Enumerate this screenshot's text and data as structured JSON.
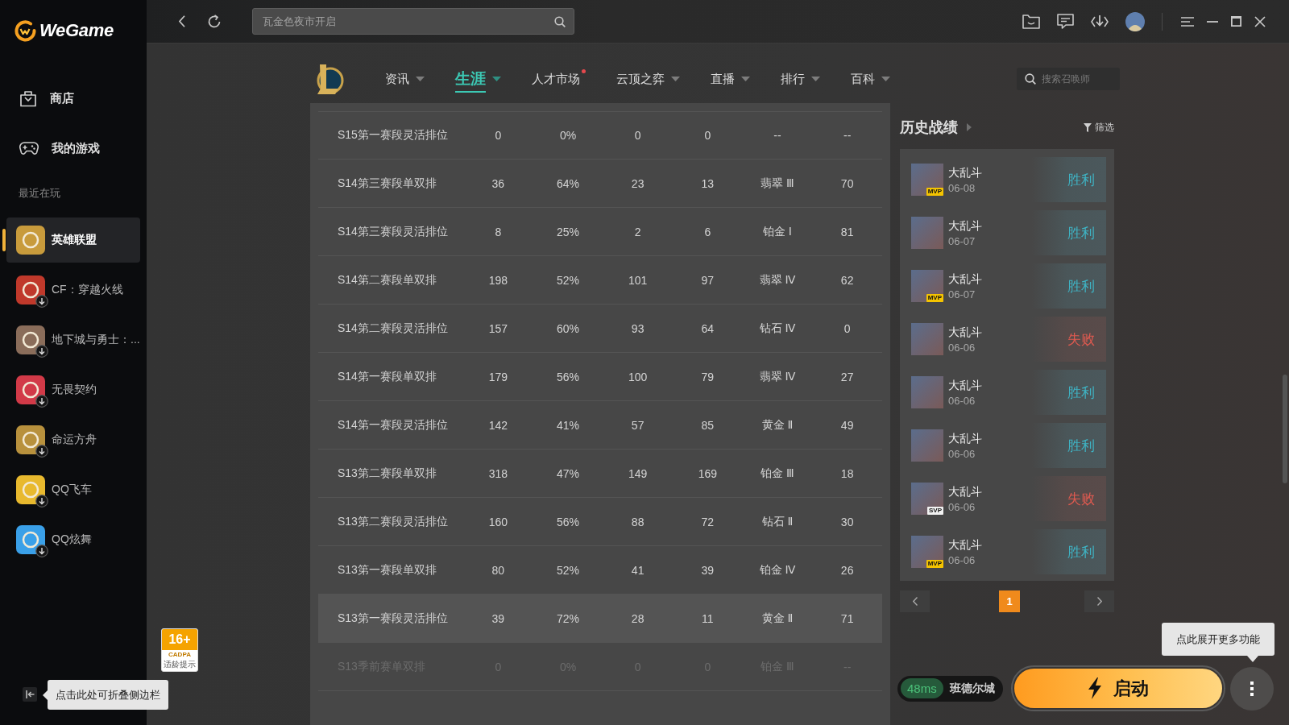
{
  "sidebar": {
    "logo": "WeGame",
    "nav": [
      {
        "label": "商店",
        "kind": "store",
        "selected": false
      },
      {
        "label": "我的游戏",
        "kind": "library",
        "selected": false
      }
    ],
    "recent_label": "最近在玩",
    "games": [
      {
        "name": "英雄联盟",
        "selected": true,
        "installed": true,
        "color": "#c89b3c"
      },
      {
        "name": "CF：穿越火线",
        "selected": false,
        "installed": false,
        "color": "#c0392b"
      },
      {
        "name": "地下城与勇士：...",
        "selected": false,
        "installed": false,
        "color": "#8a6d5a"
      },
      {
        "name": "无畏契约",
        "selected": false,
        "installed": false,
        "color": "#d23a48"
      },
      {
        "name": "命运方舟",
        "selected": false,
        "installed": false,
        "color": "#b8913d"
      },
      {
        "name": "QQ飞车",
        "selected": false,
        "installed": false,
        "color": "#e8b92e"
      },
      {
        "name": "QQ炫舞",
        "selected": false,
        "installed": false,
        "color": "#3aa0e8"
      }
    ],
    "collapse_tooltip": "点击此处可折叠侧边栏"
  },
  "toolbar": {
    "search": {
      "placeholder": "瓦金色夜市开启"
    }
  },
  "game_nav": {
    "tabs": [
      {
        "label": "资讯",
        "selected": false,
        "dropdown": true,
        "dot": false
      },
      {
        "label": "生涯",
        "selected": true,
        "dropdown": true,
        "dot": false
      },
      {
        "label": "人才市场",
        "selected": false,
        "dropdown": false,
        "dot": true
      },
      {
        "label": "云顶之弈",
        "selected": false,
        "dropdown": true,
        "dot": false
      },
      {
        "label": "直播",
        "selected": false,
        "dropdown": true,
        "dot": false
      },
      {
        "label": "排行",
        "selected": false,
        "dropdown": true,
        "dot": false
      },
      {
        "label": "百科",
        "selected": false,
        "dropdown": true,
        "dot": false
      }
    ],
    "search": {
      "placeholder": "搜索召唤师"
    }
  },
  "age_rating": {
    "rating": "16+",
    "org": "CADPA",
    "caption": "适龄提示"
  },
  "season_table": {
    "rows": [
      {
        "cells": [
          "S15第一赛段灵活排位",
          "0",
          "0%",
          "0",
          "0",
          "--",
          "--"
        ],
        "highlighted": false,
        "faded": false
      },
      {
        "cells": [
          "S14第三赛段单双排",
          "36",
          "64%",
          "23",
          "13",
          "翡翠 Ⅲ",
          "70"
        ],
        "highlighted": false,
        "faded": false
      },
      {
        "cells": [
          "S14第三赛段灵活排位",
          "8",
          "25%",
          "2",
          "6",
          "铂金 Ⅰ",
          "81"
        ],
        "highlighted": false,
        "faded": false
      },
      {
        "cells": [
          "S14第二赛段单双排",
          "198",
          "52%",
          "101",
          "97",
          "翡翠 Ⅳ",
          "62"
        ],
        "highlighted": false,
        "faded": false
      },
      {
        "cells": [
          "S14第二赛段灵活排位",
          "157",
          "60%",
          "93",
          "64",
          "钻石 Ⅳ",
          "0"
        ],
        "highlighted": false,
        "faded": false
      },
      {
        "cells": [
          "S14第一赛段单双排",
          "179",
          "56%",
          "100",
          "79",
          "翡翠 Ⅳ",
          "27"
        ],
        "highlighted": false,
        "faded": false
      },
      {
        "cells": [
          "S14第一赛段灵活排位",
          "142",
          "41%",
          "57",
          "85",
          "黄金 Ⅱ",
          "49"
        ],
        "highlighted": false,
        "faded": false
      },
      {
        "cells": [
          "S13第二赛段单双排",
          "318",
          "47%",
          "149",
          "169",
          "铂金 Ⅲ",
          "18"
        ],
        "highlighted": false,
        "faded": false
      },
      {
        "cells": [
          "S13第二赛段灵活排位",
          "160",
          "56%",
          "88",
          "72",
          "钻石 Ⅱ",
          "30"
        ],
        "highlighted": false,
        "faded": false
      },
      {
        "cells": [
          "S13第一赛段单双排",
          "80",
          "52%",
          "41",
          "39",
          "铂金 Ⅳ",
          "26"
        ],
        "highlighted": false,
        "faded": false
      },
      {
        "cells": [
          "S13第一赛段灵活排位",
          "39",
          "72%",
          "28",
          "11",
          "黄金 Ⅱ",
          "71"
        ],
        "highlighted": true,
        "faded": false
      },
      {
        "cells": [
          "S13季前赛单双排",
          "0",
          "0%",
          "0",
          "0",
          "铂金 Ⅲ",
          "--"
        ],
        "highlighted": false,
        "faded": true
      }
    ]
  },
  "history": {
    "title": "历史战绩",
    "filter": "筛选",
    "matches": [
      {
        "mode": "大乱斗",
        "date": "06-08",
        "result": "胜利",
        "win": true,
        "badge": {
          "label": "MVP",
          "kind": "mvp"
        }
      },
      {
        "mode": "大乱斗",
        "date": "06-07",
        "result": "胜利",
        "win": true
      },
      {
        "mode": "大乱斗",
        "date": "06-07",
        "result": "胜利",
        "win": true,
        "badge": {
          "label": "MVP",
          "kind": "mvp"
        }
      },
      {
        "mode": "大乱斗",
        "date": "06-06",
        "result": "失败",
        "win": false
      },
      {
        "mode": "大乱斗",
        "date": "06-06",
        "result": "胜利",
        "win": true
      },
      {
        "mode": "大乱斗",
        "date": "06-06",
        "result": "胜利",
        "win": true
      },
      {
        "mode": "大乱斗",
        "date": "06-06",
        "result": "失败",
        "win": false,
        "badge": {
          "label": "SVP",
          "kind": "svp"
        }
      },
      {
        "mode": "大乱斗",
        "date": "06-06",
        "result": "胜利",
        "win": true,
        "badge": {
          "label": "MVP",
          "kind": "mvp"
        }
      }
    ],
    "pages": [
      {
        "label": "1",
        "selected": true
      }
    ]
  },
  "launch": {
    "ping": "48ms",
    "server": "班德尔城",
    "start": "启动",
    "more_tooltip": "点此展开更多功能"
  }
}
